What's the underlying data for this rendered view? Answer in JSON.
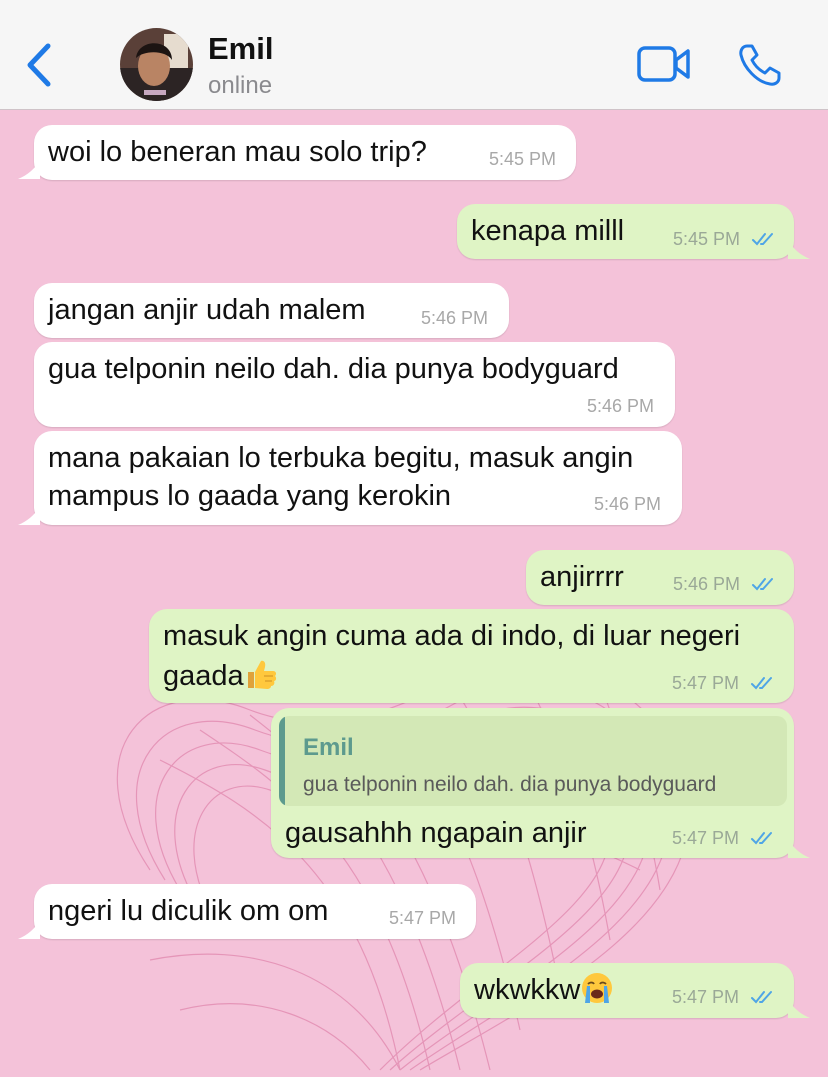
{
  "contact": {
    "name": "Emil",
    "status": "online"
  },
  "colors": {
    "wallpaper": "#f4c2d9",
    "incoming_bubble": "#ffffff",
    "outgoing_bubble": "#dff4c5",
    "accent": "#1f7ae6",
    "read_ticks": "#4fa5e6"
  },
  "icons": {
    "back": "chevron-left-icon",
    "video": "video-camera-icon",
    "call": "phone-icon"
  },
  "messages": [
    {
      "dir": "in",
      "text": "woi lo beneran mau solo trip?",
      "time": "5:45 PM"
    },
    {
      "dir": "out",
      "text": "kenapa milll",
      "time": "5:45 PM",
      "status": "read"
    },
    {
      "dir": "in",
      "text": "jangan anjir udah malem",
      "time": "5:46 PM"
    },
    {
      "dir": "in",
      "text": "gua telponin neilo dah. dia punya bodyguard",
      "time": "5:46 PM"
    },
    {
      "dir": "in",
      "line1": "mana pakaian lo terbuka begitu, masuk angin",
      "line2": "mampus lo gaada yang kerokin",
      "time": "5:46 PM"
    },
    {
      "dir": "out",
      "text": "anjirrrr",
      "time": "5:46 PM",
      "status": "read"
    },
    {
      "dir": "out",
      "line1": "masuk angin cuma ada di indo, di luar negeri",
      "line2": "gaada",
      "emoji": "thumbs-up",
      "time": "5:47 PM",
      "status": "read"
    },
    {
      "dir": "out",
      "reply_to": {
        "name": "Emil",
        "text": "gua telponin neilo dah. dia punya bodyguard"
      },
      "text": "gausahhh ngapain anjir",
      "time": "5:47 PM",
      "status": "read"
    },
    {
      "dir": "in",
      "text": "ngeri lu diculik om om",
      "time": "5:47 PM"
    },
    {
      "dir": "out",
      "text": "wkwkkw",
      "emoji": "loudly-crying-face",
      "time": "5:47 PM",
      "status": "read"
    }
  ]
}
